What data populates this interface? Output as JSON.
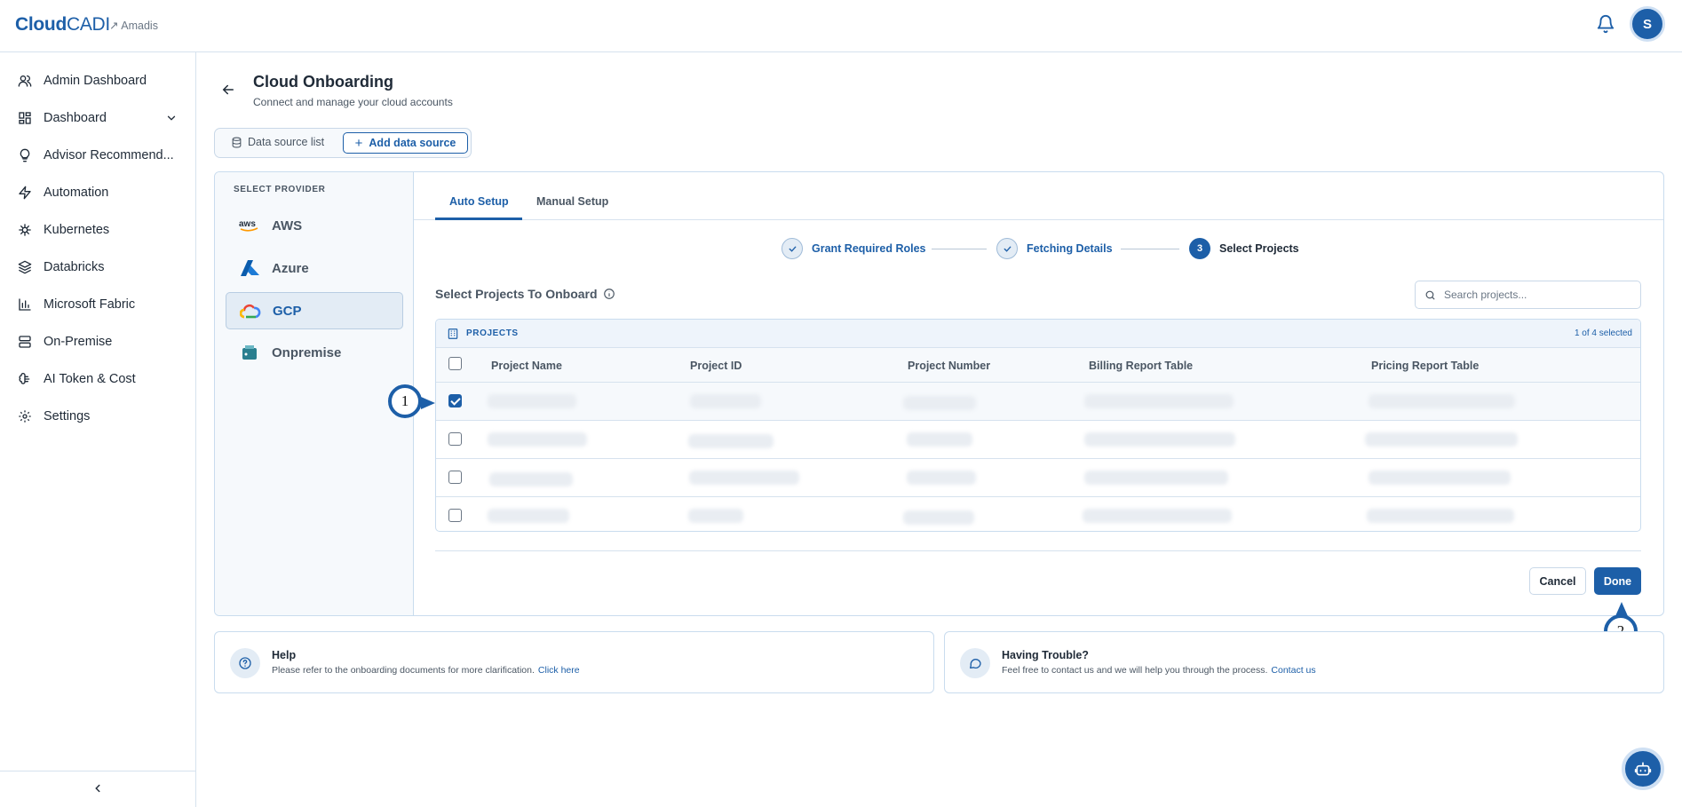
{
  "app": {
    "logo_bold": "Cloud",
    "logo_thin": "CADI",
    "tenant": "↗ Amadis",
    "avatar_letter": "S",
    "accent": "#1d5fa8"
  },
  "sidebar": {
    "items": [
      {
        "label": "Admin Dashboard",
        "icon": "users-icon"
      },
      {
        "label": "Dashboard",
        "icon": "grid-icon"
      },
      {
        "label": "Advisor Recommend...",
        "icon": "lightbulb-icon"
      },
      {
        "label": "Automation",
        "icon": "bolt-icon"
      },
      {
        "label": "Kubernetes",
        "icon": "helm-icon"
      },
      {
        "label": "Databricks",
        "icon": "layers-icon"
      },
      {
        "label": "Microsoft Fabric",
        "icon": "bar-chart-icon"
      },
      {
        "label": "On-Premise",
        "icon": "server-icon"
      },
      {
        "label": "AI Token & Cost",
        "icon": "ai-icon"
      },
      {
        "label": "Settings",
        "icon": "gear-icon"
      }
    ]
  },
  "header": {
    "title": "Cloud Onboarding",
    "subtitle": "Connect and manage your cloud accounts"
  },
  "datasource": {
    "list_label": "Data source list",
    "add_label": "Add data source"
  },
  "providers": {
    "heading": "SELECT PROVIDER",
    "items": [
      {
        "label": "AWS",
        "active": false
      },
      {
        "label": "Azure",
        "active": false
      },
      {
        "label": "GCP",
        "active": true
      },
      {
        "label": "Onpremise",
        "active": false
      }
    ]
  },
  "tabs": {
    "auto": "Auto Setup",
    "manual": "Manual Setup"
  },
  "steps": [
    {
      "label": "Grant Required Roles",
      "state": "done"
    },
    {
      "label": "Fetching Details",
      "state": "done"
    },
    {
      "label": "Select Projects",
      "state": "current",
      "number": "3"
    }
  ],
  "projects": {
    "title": "Select Projects To Onboard",
    "search_placeholder": "Search projects...",
    "table_title": "PROJECTS",
    "count": "1 of 4 selected",
    "columns": [
      "Project Name",
      "Project ID",
      "Project Number",
      "Billing Report Table",
      "Pricing Report Table"
    ],
    "rows": [
      {
        "checked": true
      },
      {
        "checked": false
      },
      {
        "checked": false
      },
      {
        "checked": false
      }
    ]
  },
  "actions": {
    "cancel": "Cancel",
    "done": "Done"
  },
  "callouts": {
    "one": "1",
    "two": "2"
  },
  "help": {
    "title": "Help",
    "desc": "Please refer to the onboarding documents for more clarification.",
    "link": "Click here"
  },
  "trouble": {
    "title": "Having Trouble?",
    "desc": "Feel free to contact us and we will help you through the process.",
    "link": "Contact us"
  }
}
